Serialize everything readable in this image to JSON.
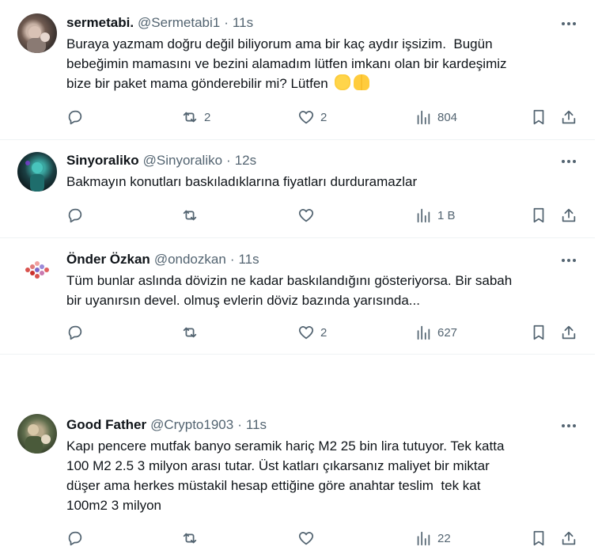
{
  "colors": {
    "text": "#0f1419",
    "muted": "#536471",
    "divider": "#eff3f4"
  },
  "tweets": [
    {
      "name": "sermetabi.",
      "handle": "@Sermetabi1",
      "separator": "·",
      "time": "11s",
      "lines": [
        "Buraya yazmam doğru değil biliyorum ama bir kaç aydır işsizim.  Bugün",
        "bebeğimin mamasını ve bezini alamadım lütfen imkanı olan bir kardeşimiz",
        "bize bir paket mama gönderebilir mi? Lütfen"
      ],
      "emojis": [
        "pleading-hands-emoji",
        "folded-hands-emoji"
      ],
      "replies": "",
      "retweets": "2",
      "likes": "2",
      "views": "804"
    },
    {
      "name": "Sinyoraliko",
      "handle": "@Sinyoraliko",
      "separator": "·",
      "time": "12s",
      "lines": [
        "Bakmayın konutları baskıladıklarına fiyatları durduramazlar"
      ],
      "replies": "",
      "retweets": "",
      "likes": "",
      "views": "1 B"
    },
    {
      "name": "Önder Özkan",
      "handle": "@ondozkan",
      "separator": "·",
      "time": "11s",
      "lines": [
        "Tüm bunlar aslında dövizin ne kadar baskılandığını gösteriyorsa. Bir sabah",
        "bir uyanırsın devel. olmuş evlerin döviz bazında yarısında..."
      ],
      "replies": "",
      "retweets": "",
      "likes": "2",
      "views": "627"
    },
    {
      "name": "Good Father",
      "handle": "@Crypto1903",
      "separator": "·",
      "time": "11s",
      "lines": [
        "Kapı pencere mutfak banyo seramik hariç M2 25 bin lira tutuyor. Tek katta",
        "100 M2 2.5 3 milyon arası tutar. Üst katları çıkarsanız maliyet bir miktar",
        "düşer ama herkes müstakil hesap ettiğine göre anahtar teslim  tek kat",
        "100m2 3 milyon"
      ],
      "replies": "",
      "retweets": "",
      "likes": "",
      "views": "22"
    }
  ]
}
